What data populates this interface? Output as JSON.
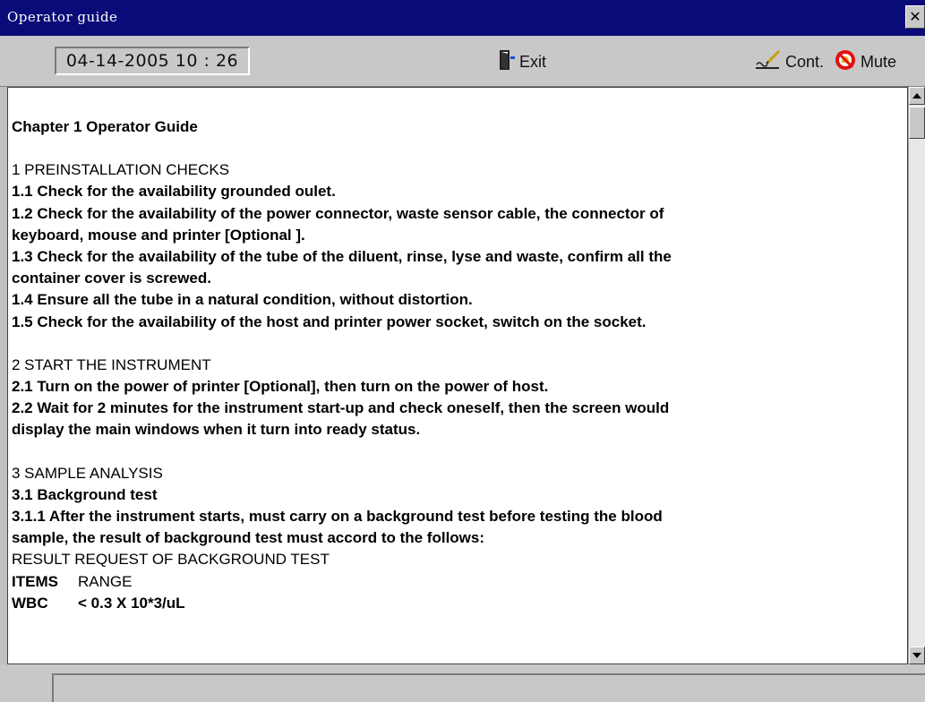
{
  "window": {
    "title": "Operator guide",
    "close_label": "✕"
  },
  "toolbar": {
    "datetime": "04-14-2005  10 : 26",
    "exit_label": "Exit",
    "cont_label": "Cont.",
    "mute_label": "Mute"
  },
  "content": {
    "chapter_title": "Chapter 1 Operator Guide",
    "s1_heading": "1 PREINSTALLATION CHECKS",
    "s1_1": "1.1 Check for the availability grounded oulet.",
    "s1_2a": "1.2 Check for the availability of the power connector, waste sensor cable, the connector of",
    "s1_2b": "keyboard, mouse and printer [Optional ].",
    "s1_3a": "1.3 Check for the availability of the tube of the diluent, rinse, lyse and waste, confirm all the",
    "s1_3b": "container cover is screwed.",
    "s1_4": "1.4 Ensure all the tube in a natural condition, without distortion.",
    "s1_5": "1.5 Check for the availability of the host and printer power socket, switch on the socket.",
    "s2_heading": "2 START THE INSTRUMENT",
    "s2_1": "2.1 Turn on the power of printer [Optional], then turn on the power of host.",
    "s2_2a": "2.2 Wait for 2 minutes for the instrument start-up and check oneself, then the screen would",
    "s2_2b": "display the main windows when it turn into ready status.",
    "s3_heading": "3 SAMPLE ANALYSIS",
    "s3_1": "3.1 Background test",
    "s3_1_1a": "3.1.1 After the instrument starts, must carry on a background test before testing the blood",
    "s3_1_1b": "sample, the result of background test must accord to the follows:",
    "result_title": "RESULT REQUEST OF BACKGROUND TEST",
    "col_items": "ITEMS",
    "col_range": "RANGE",
    "row1_item": "WBC",
    "row1_range": "< 0.3 X 10*3/uL"
  }
}
